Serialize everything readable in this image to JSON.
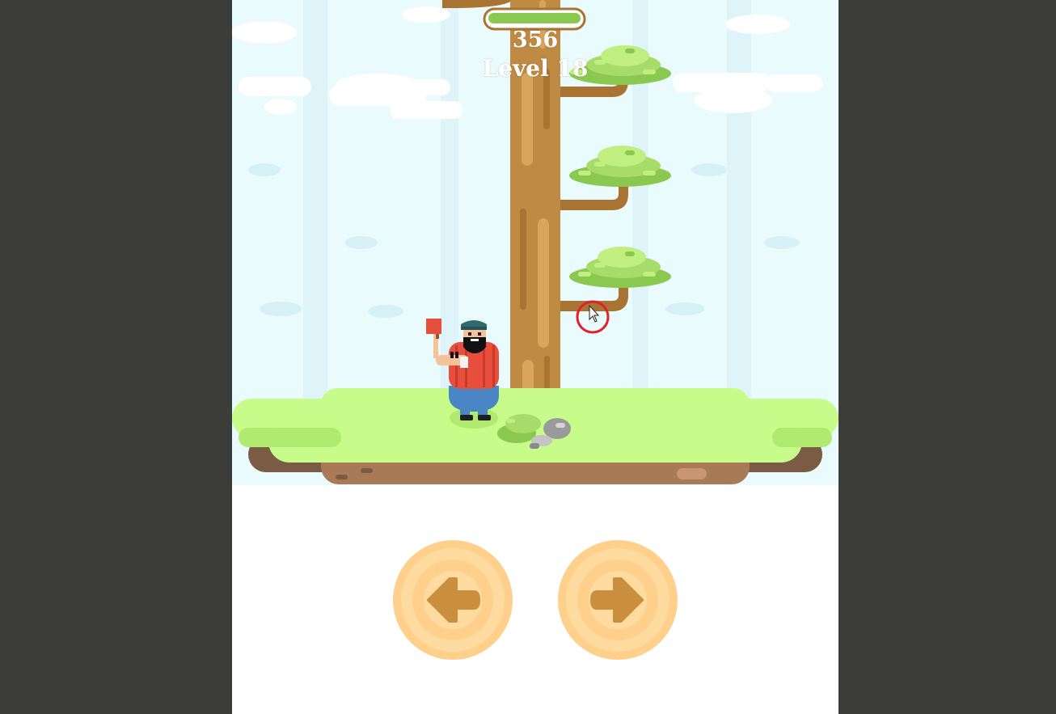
{
  "hud": {
    "score": "356",
    "level": "Level 18",
    "time_remaining_fraction": 1.0
  },
  "colors": {
    "background_outer": "#3c3c3b",
    "sky": "#e9fbfd",
    "tree_trunk": "#be8a44",
    "leaves": "#a8dc6a",
    "grass": "#c7fb8a",
    "soil": "#a87a55",
    "button": "#ffd89a",
    "arrow": "#c98f3f",
    "lumberjack_shirt": "#e84e3c"
  },
  "controls": {
    "left_icon": "arrow-left-icon",
    "right_icon": "arrow-right-icon"
  },
  "player": {
    "side": "left",
    "icon": "lumberjack"
  },
  "branches": [
    "none",
    "right",
    "right",
    "right"
  ]
}
